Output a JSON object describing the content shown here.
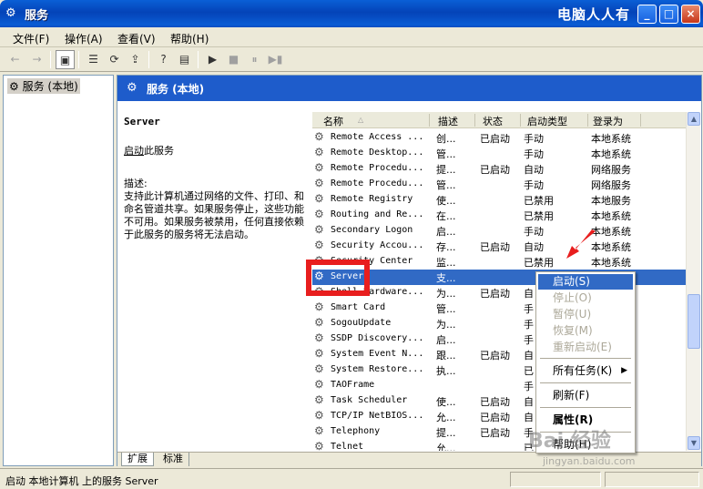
{
  "window": {
    "title": "服务",
    "watermark": "电脑人人有",
    "buttons": {
      "minimize": "_",
      "maximize": "□",
      "close": "×"
    }
  },
  "menu": [
    "文件(F)",
    "操作(A)",
    "查看(V)",
    "帮助(H)"
  ],
  "toolbar": {
    "back": "←",
    "forward": "→",
    "show_tree": "▣",
    "properties": "☰",
    "refresh": "⟳",
    "export": "⇪",
    "help": "?",
    "console": "▤",
    "start": "▶",
    "stop": "■",
    "pause": "⏸",
    "restart": "▶▮"
  },
  "tree": {
    "root": "服务 (本地)"
  },
  "header": {
    "title": "服务 (本地)"
  },
  "description": {
    "service_name": "Server",
    "start_link": "启动",
    "start_suffix": "此服务",
    "label": "描述:",
    "text": "支持此计算机通过网络的文件、打印、和命名管道共享。如果服务停止，这些功能不可用。如果服务被禁用，任何直接依赖于此服务的服务将无法启动。"
  },
  "columns": {
    "name": "名称",
    "sort_arrow": "△",
    "desc": "描述",
    "status": "状态",
    "startup": "启动类型",
    "logon": "登录为"
  },
  "rows": [
    {
      "name": "Remote Access ...",
      "desc": "创...",
      "status": "已启动",
      "startup": "手动",
      "logon": "本地系统"
    },
    {
      "name": "Remote Desktop...",
      "desc": "管...",
      "status": "",
      "startup": "手动",
      "logon": "本地系统"
    },
    {
      "name": "Remote Procedu...",
      "desc": "提...",
      "status": "已启动",
      "startup": "自动",
      "logon": "网络服务"
    },
    {
      "name": "Remote Procedu...",
      "desc": "管...",
      "status": "",
      "startup": "手动",
      "logon": "网络服务"
    },
    {
      "name": "Remote Registry",
      "desc": "使...",
      "status": "",
      "startup": "已禁用",
      "logon": "本地服务"
    },
    {
      "name": "Routing and Re...",
      "desc": "在...",
      "status": "",
      "startup": "已禁用",
      "logon": "本地系统"
    },
    {
      "name": "Secondary Logon",
      "desc": "启...",
      "status": "",
      "startup": "手动",
      "logon": "本地系统"
    },
    {
      "name": "Security Accou...",
      "desc": "存...",
      "status": "已启动",
      "startup": "自动",
      "logon": "本地系统"
    },
    {
      "name": "Security Center",
      "desc": "监...",
      "status": "",
      "startup": "已禁用",
      "logon": "本地系统"
    },
    {
      "name": "Server",
      "desc": "支...",
      "status": "",
      "startup": "",
      "logon": ""
    },
    {
      "name": "Shell Hardware...",
      "desc": "为...",
      "status": "已启动",
      "startup": "自",
      "logon": ""
    },
    {
      "name": "Smart Card",
      "desc": "管...",
      "status": "",
      "startup": "手",
      "logon": ""
    },
    {
      "name": "SogouUpdate",
      "desc": "为...",
      "status": "",
      "startup": "手",
      "logon": ""
    },
    {
      "name": "SSDP Discovery...",
      "desc": "启...",
      "status": "",
      "startup": "手",
      "logon": ""
    },
    {
      "name": "System Event N...",
      "desc": "跟...",
      "status": "已启动",
      "startup": "自",
      "logon": ""
    },
    {
      "name": "System Restore...",
      "desc": "执...",
      "status": "",
      "startup": "已",
      "logon": ""
    },
    {
      "name": "TAOFrame",
      "desc": "",
      "status": "",
      "startup": "手",
      "logon": ""
    },
    {
      "name": "Task Scheduler",
      "desc": "使...",
      "status": "已启动",
      "startup": "自",
      "logon": ""
    },
    {
      "name": "TCP/IP NetBIOS...",
      "desc": "允...",
      "status": "已启动",
      "startup": "自",
      "logon": ""
    },
    {
      "name": "Telephony",
      "desc": "提...",
      "status": "已启动",
      "startup": "手",
      "logon": ""
    },
    {
      "name": "Telnet",
      "desc": "允...",
      "status": "",
      "startup": "已",
      "logon": ""
    }
  ],
  "context_menu": {
    "start": "启动(S)",
    "stop": "停止(O)",
    "pause": "暂停(U)",
    "resume": "恢复(M)",
    "restart": "重新启动(E)",
    "all_tasks": "所有任务(K)",
    "submenu_arrow": "▶",
    "refresh": "刷新(F)",
    "properties": "属性(R)",
    "help": "帮助(H)"
  },
  "tabs": {
    "extended": "扩展",
    "standard": "标准"
  },
  "status_bar": "启动 本地计算机 上的服务 Server",
  "watermark_overlay": {
    "logo": "Bai 经验",
    "url": "jingyan.baidu.com"
  },
  "colors": {
    "title_blue": "#0A5FD6",
    "selection": "#316AC5",
    "highlight_red": "#E81E1E"
  }
}
